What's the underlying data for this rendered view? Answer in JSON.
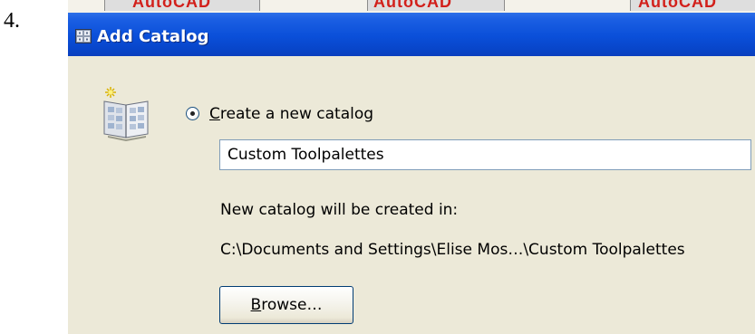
{
  "step_number": "4.",
  "behind_window": {
    "fragment_text": "AutoCAD"
  },
  "dialog": {
    "title": "Add Catalog",
    "title_icon": "catalog-grid-icon",
    "catalog_icon": "open-book-catalog-icon",
    "radio": {
      "label_accel": "C",
      "label_rest": "reate a new catalog",
      "selected": true
    },
    "name_field": {
      "value": "Custom Toolpalettes"
    },
    "location_label": "New catalog will be created in:",
    "location_path": "C:\\Documents and Settings\\Elise Mos…\\Custom Toolpalettes",
    "browse_button": {
      "accel": "B",
      "rest": "rowse…"
    }
  },
  "colors": {
    "titlebar": "#0a4fd9",
    "dialog_bg": "#ece9d8",
    "input_border": "#7f9db9",
    "button_border": "#003c74"
  }
}
